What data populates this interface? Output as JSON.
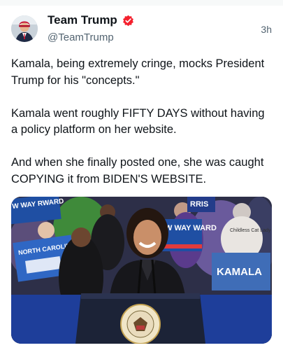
{
  "author": {
    "name": "Team Trump",
    "handle": "@TeamTrump",
    "avatar_icon": "profile-photo-icon",
    "badge_icon": "verified-badge-icon",
    "badge_color": "#f4212e"
  },
  "post": {
    "timestamp": "3h",
    "paragraphs": [
      "Kamala, being extremely cringe, mocks President Trump for his \"concepts.\"",
      "Kamala went roughly FIFTY DAYS without having a policy platform on her website.",
      "And when she finally posted one, she was caught COPYING it from BIDEN'S WEBSITE."
    ]
  },
  "media": {
    "signs": {
      "top_left": "W WAY RWARD",
      "top_right": "RRIS",
      "mid_right": "W WAY WARD",
      "north_carolina": "NORTH CAROLINA",
      "far_right": "KAMALA",
      "shirt_right": "Childless Cat Lady"
    },
    "podium_seal": "THE PRESIDENT OF THE UNITED STATES"
  },
  "colors": {
    "text": "#0f1419",
    "secondary": "#536471",
    "accent_blue": "#1d4ea8",
    "crowd_bg": "#2a2c44"
  }
}
